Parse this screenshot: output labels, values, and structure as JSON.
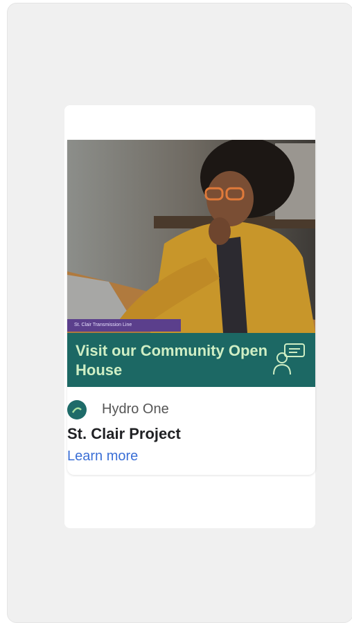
{
  "ad": {
    "tag_label": "St. Clair Transmission Line",
    "banner_title": "Visit our Community Open House",
    "advertiser": "Hydro One",
    "headline": "St. Clair Project",
    "cta": "Learn more",
    "icons": {
      "banner": "presenter-speech-bubble-icon",
      "logo": "hydro-one-logo"
    },
    "colors": {
      "banner_bg": "#1c6864",
      "banner_text": "#cfeec4",
      "tag_bg": "#5b3f8c",
      "link": "#3b6fd6"
    }
  }
}
